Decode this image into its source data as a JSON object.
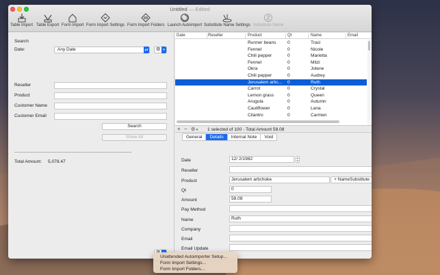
{
  "window": {
    "title": "Untitled",
    "edited_suffix": "— Edited"
  },
  "toolbar": [
    {
      "label": "Table Import",
      "icon": "table-import-icon"
    },
    {
      "label": "Table Export",
      "icon": "table-export-icon"
    },
    {
      "label": "Form Import",
      "icon": "form-import-icon"
    },
    {
      "label": "Form Import Settings",
      "icon": "form-import-settings-icon"
    },
    {
      "label": "Form Import Folders",
      "icon": "form-import-folders-icon"
    },
    {
      "label": "Launch Autoimport",
      "icon": "launch-autoimport-icon"
    },
    {
      "label": "Substitute Name Settings",
      "icon": "substitute-name-settings-icon"
    },
    {
      "label": "Substitute Name",
      "icon": "substitute-name-icon",
      "disabled": true
    }
  ],
  "search": {
    "heading": "Search",
    "date_label": "Date:",
    "date_value": "Any Date",
    "reseller_label": "Reseller",
    "product_label": "Product",
    "customer_name_label": "Customer Name",
    "customer_email_label": "Customer Email",
    "search_button": "Search",
    "show_all_button": "Show All",
    "separator": "------------------------------------------------------------------------------",
    "total_label": "Total Amount:",
    "total_value": "5,078.47"
  },
  "table": {
    "columns": [
      "Date",
      "Reseller",
      "Product",
      "Qt",
      "Name",
      "Email"
    ],
    "rows": [
      {
        "product": "Runner beans",
        "qt": "0",
        "name": "Traci"
      },
      {
        "product": "Fennel",
        "qt": "0",
        "name": "Nicole"
      },
      {
        "product": "Chili pepper",
        "qt": "0",
        "name": "Marietta"
      },
      {
        "product": "Fennel",
        "qt": "0",
        "name": "Mitzi"
      },
      {
        "product": "Okra",
        "qt": "0",
        "name": "Jolene"
      },
      {
        "product": "Chili pepper",
        "qt": "0",
        "name": "Audrey"
      },
      {
        "product": "Jerusalem artic...",
        "qt": "0",
        "name": "Ruth",
        "selected": true
      },
      {
        "product": "Carrot",
        "qt": "0",
        "name": "Crystal"
      },
      {
        "product": "Lemon grass",
        "qt": "0",
        "name": "Queen"
      },
      {
        "product": "Arugula",
        "qt": "0",
        "name": "Autumn"
      },
      {
        "product": "Cauliflower",
        "qt": "0",
        "name": "Lana"
      },
      {
        "product": "Cilantro",
        "qt": "0",
        "name": "Carmen"
      }
    ],
    "footer": {
      "add": "+",
      "remove": "−",
      "status": "1 selected of 100 - Total Amount 58.08"
    }
  },
  "details": {
    "tabs": [
      "General",
      "Details",
      "Internal Note",
      "Void"
    ],
    "active_tab": "Details",
    "labels": {
      "date": "Date",
      "reseller": "Reseller",
      "product": "Product",
      "qt": "Qt",
      "amount": "Amount",
      "pay_method": "Pay Method",
      "name": "Name",
      "company": "Company",
      "email": "Email",
      "email_update": "Email Update"
    },
    "values": {
      "date": "12/  2/1982",
      "reseller": "",
      "product": "Jerusalem artichoke",
      "qt": "0",
      "amount": "58.08",
      "pay_method": "",
      "name": "Ruth",
      "company": "",
      "email": "",
      "email_update": ""
    },
    "name_substitute_button": "+ NameSubstitute"
  },
  "context_menu": [
    "Unattended Autoimporter Setup...",
    "Form Import Settings...",
    "Form Import Folders..."
  ],
  "colors": {
    "accent": "#1a6cf0",
    "selection": "#0b5ed7"
  }
}
